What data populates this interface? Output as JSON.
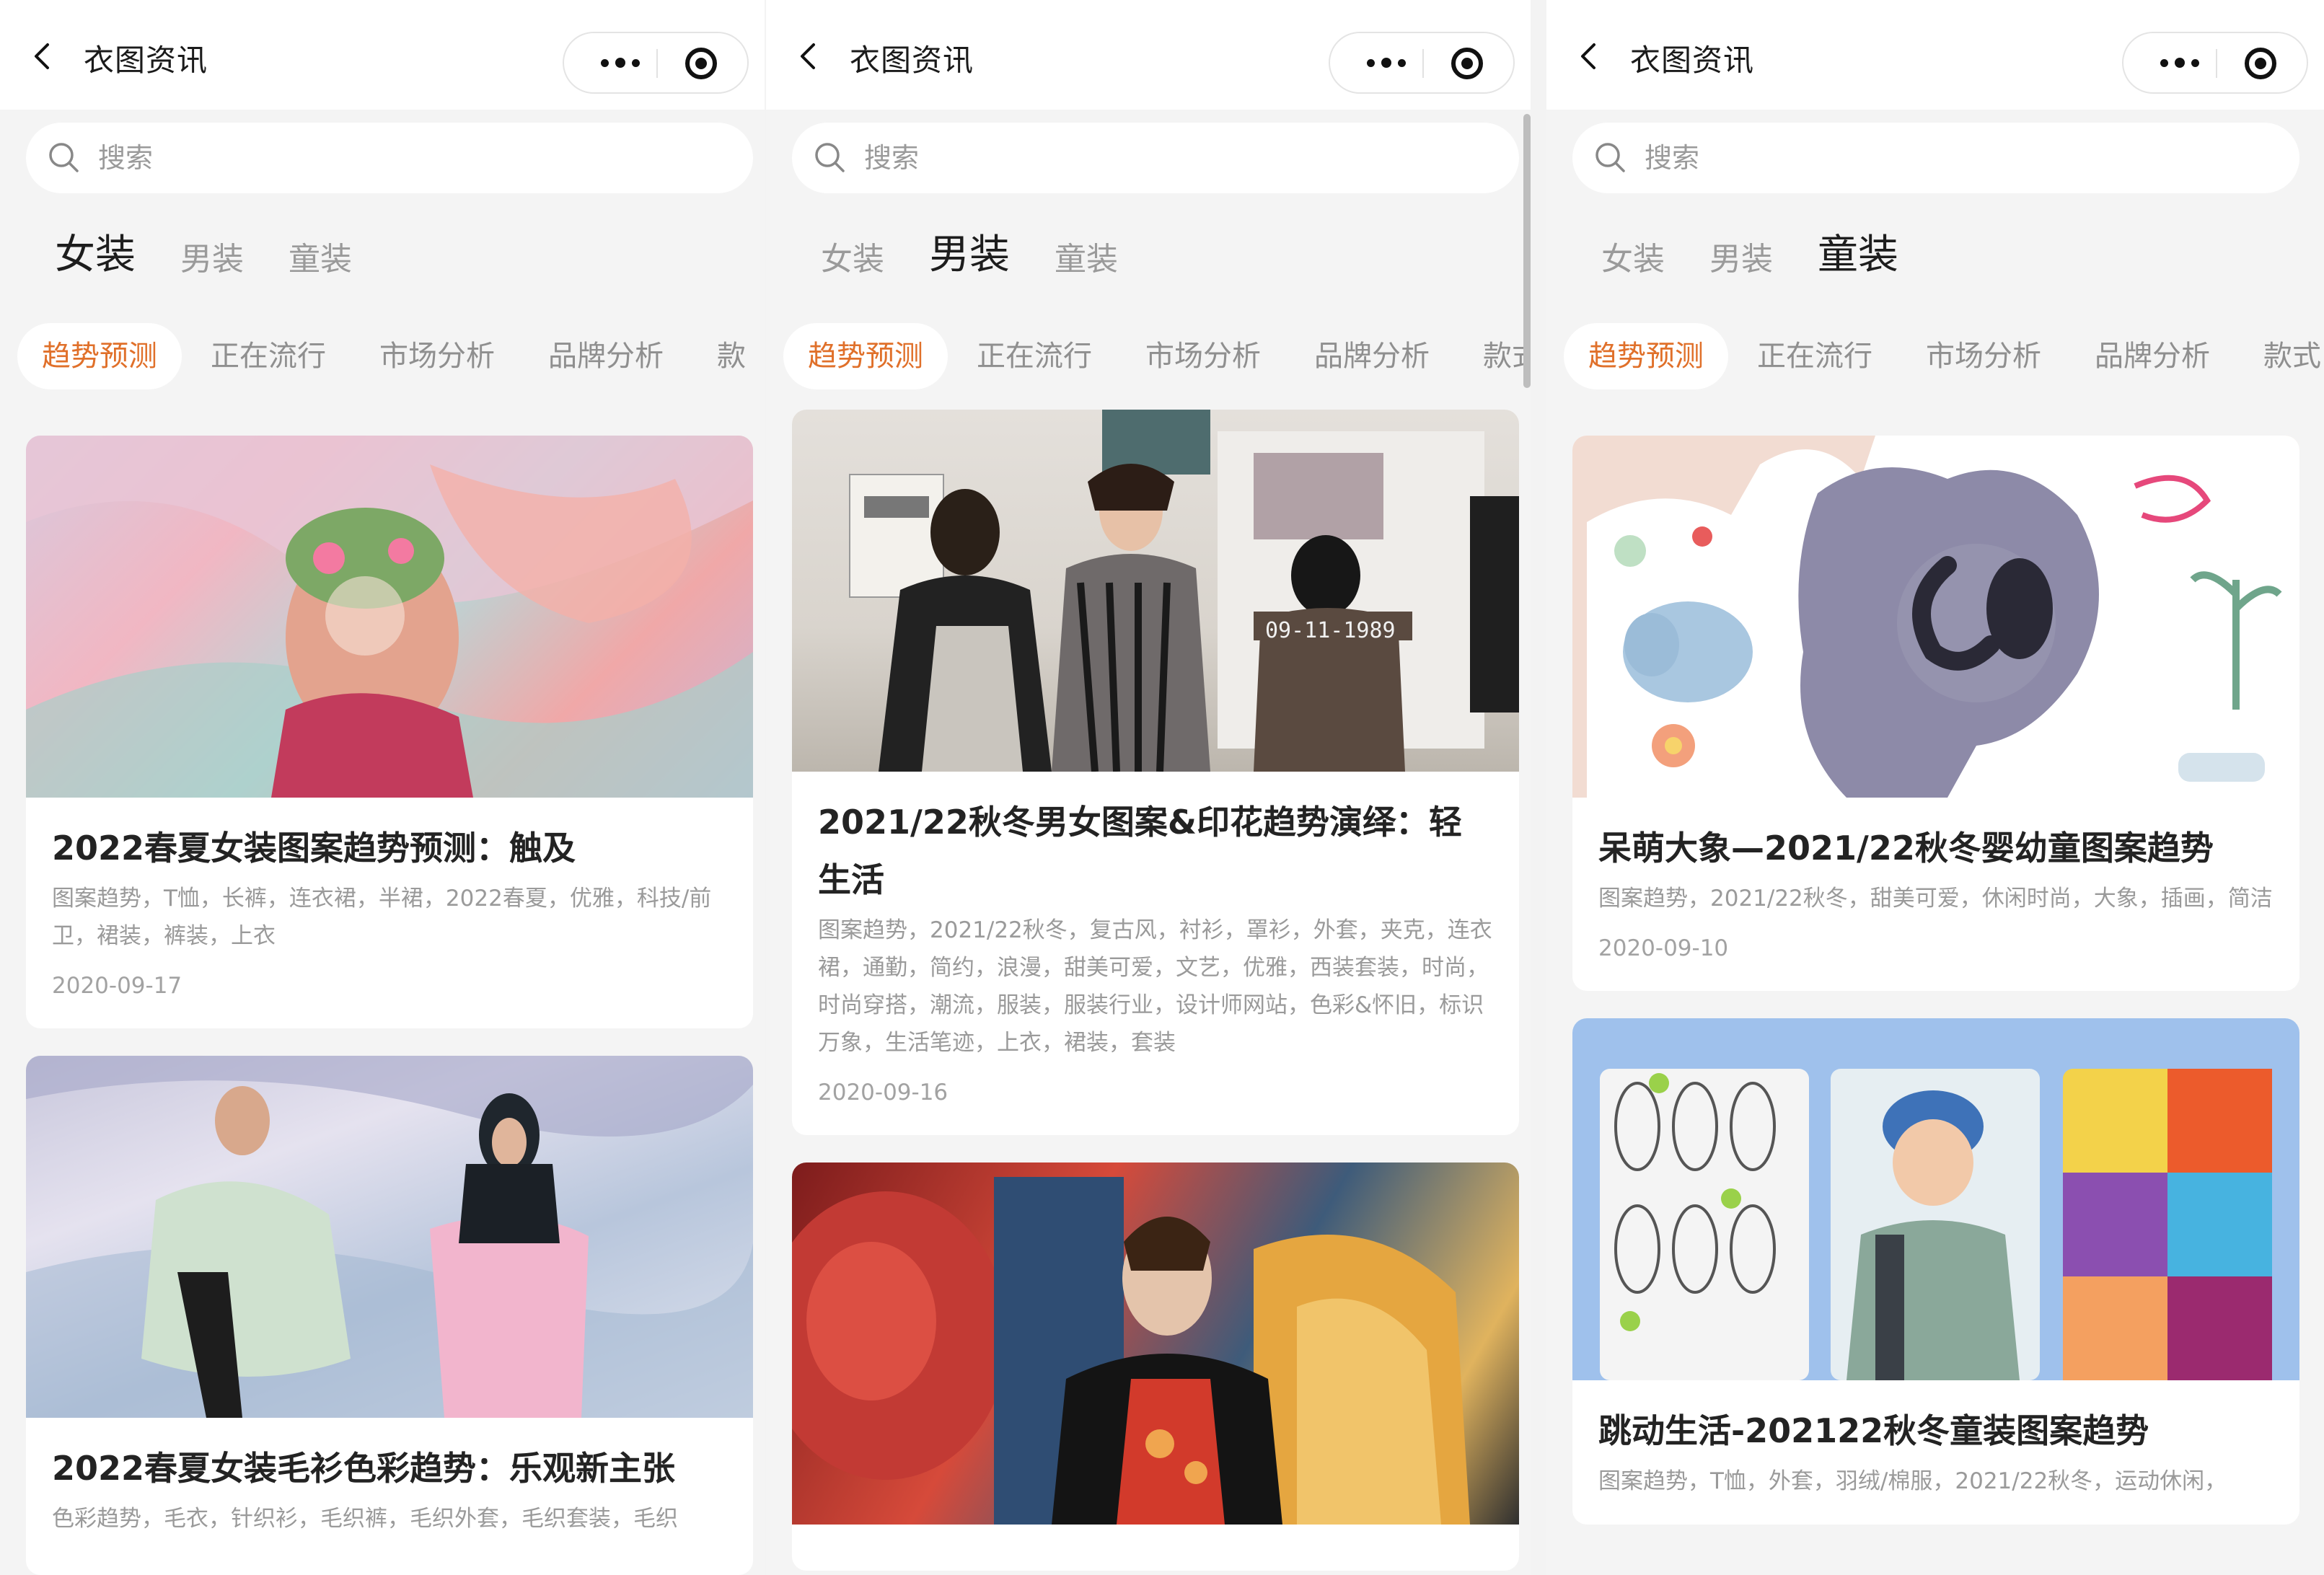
{
  "panels": [
    {
      "topbar": {
        "title": "衣图资讯"
      },
      "search": {
        "placeholder": "搜索"
      },
      "categories": [
        "女装",
        "男装",
        "童装"
      ],
      "active_category": 0,
      "subtabs": [
        "趋势预测",
        "正在流行",
        "市场分析",
        "品牌分析",
        "款"
      ],
      "cards": [
        {
          "title": "2022春夏女装图案趋势预测：触及",
          "tags": "图案趋势，T恤，长裤，连衣裙，半裙，2022春夏，优雅，科技/前卫，裙装，裤装，上衣",
          "date": "2020-09-17"
        },
        {
          "title": "2022春夏女装毛衫色彩趋势：乐观新主张",
          "tags": "色彩趋势，毛衣，针织衫，毛织裤，毛织外套，毛织套装，毛织",
          "date": ""
        }
      ]
    },
    {
      "topbar": {
        "title": "衣图资讯"
      },
      "search": {
        "placeholder": "搜索"
      },
      "categories": [
        "女装",
        "男装",
        "童装"
      ],
      "active_category": 1,
      "subtabs": [
        "趋势预测",
        "正在流行",
        "市场分析",
        "品牌分析",
        "款式"
      ],
      "cards": [
        {
          "title": "2021/22秋冬男女图案&印花趋势演绎：轻生活",
          "tags": "图案趋势，2021/22秋冬，复古风，衬衫，罩衫，外套，夹克，连衣裙，通勤，简约，浪漫，甜美可爱，文艺，优雅，西装套装，时尚，时尚穿搭，潮流，服装，服装行业，设计师网站，色彩&怀旧，标识万象，生活笔迹，上衣，裙装，套装",
          "date": "2020-09-16",
          "image_text": "09-11-1989"
        },
        {
          "title": "",
          "tags": "",
          "date": ""
        }
      ]
    },
    {
      "topbar": {
        "title": "衣图资讯"
      },
      "search": {
        "placeholder": "搜索"
      },
      "categories": [
        "女装",
        "男装",
        "童装"
      ],
      "active_category": 2,
      "subtabs": [
        "趋势预测",
        "正在流行",
        "市场分析",
        "品牌分析",
        "款式"
      ],
      "cards": [
        {
          "title": "呆萌大象—2021/22秋冬婴幼童图案趋势",
          "tags": "图案趋势，2021/22秋冬，甜美可爱，休闲时尚，大象，插画，简洁",
          "date": "2020-09-10"
        },
        {
          "title": "跳动生活-202122秋冬童装图案趋势",
          "tags": "图案趋势，T恤，外套，羽绒/棉服，2021/22秋冬，运动休闲，",
          "date": ""
        }
      ]
    }
  ],
  "colors": {
    "accent": "#e0702a",
    "background": "#f4f4f4",
    "card": "#ffffff"
  },
  "icons": {
    "back": "chevron-left-icon",
    "more": "more-dots-icon",
    "record": "record-icon",
    "search": "search-icon"
  }
}
